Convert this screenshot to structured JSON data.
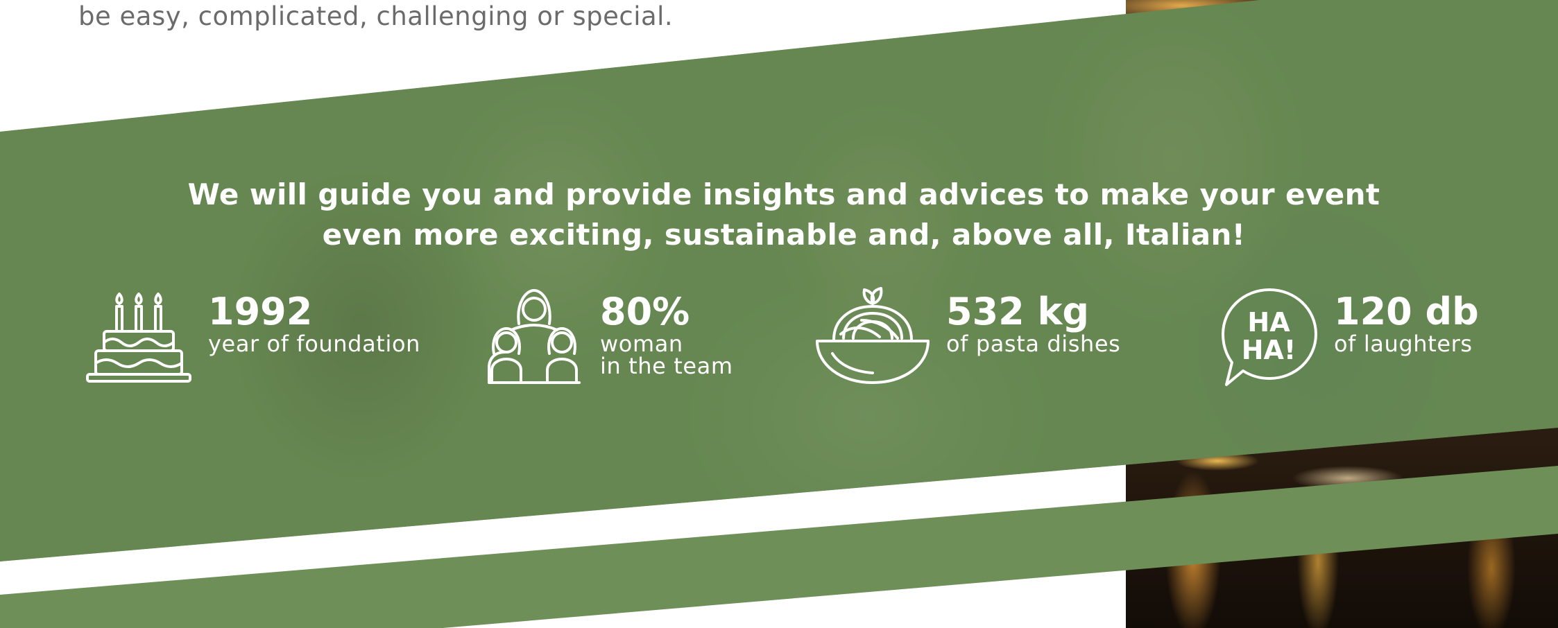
{
  "intro": {
    "text": "be easy, complicated, challenging or special."
  },
  "headline": {
    "line1": "We will guide you and provide insights and advices to make your event",
    "line2": "even more exciting, sustainable and, above all, Italian!"
  },
  "stats": [
    {
      "icon": "birthday-cake-icon",
      "value": "1992",
      "label": "year of foundation"
    },
    {
      "icon": "women-team-icon",
      "value": "80%",
      "label": "woman\nin the team"
    },
    {
      "icon": "pasta-bowl-icon",
      "value": "532 kg",
      "label": "of pasta dishes"
    },
    {
      "icon": "haha-speech-bubble-icon",
      "value": "120 db",
      "label": "of laughters"
    }
  ],
  "bubble": {
    "line1": "HA",
    "line2": "HA!"
  },
  "colors": {
    "green": "#678a52",
    "stripe": "#6f8f58",
    "text_gray": "#6b6b6b",
    "white": "#ffffff"
  }
}
